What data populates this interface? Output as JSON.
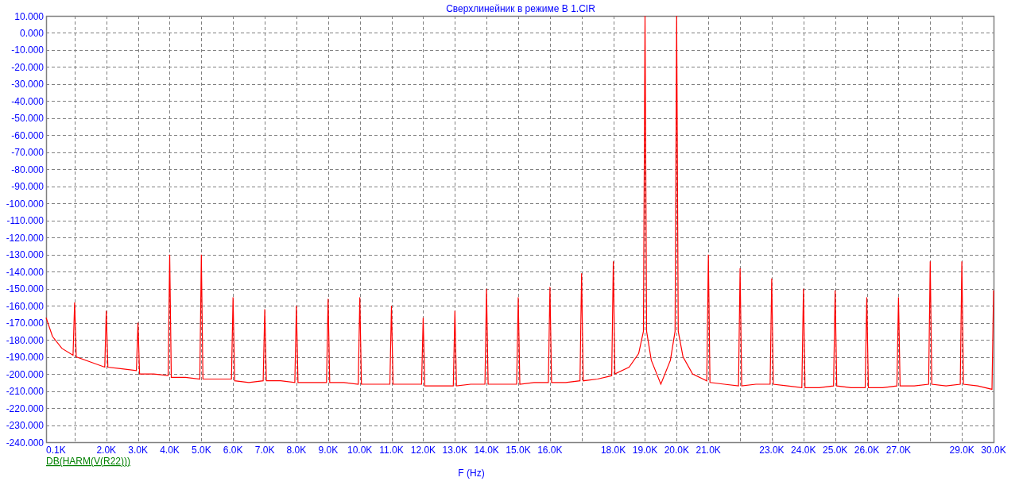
{
  "chart_data": {
    "type": "line",
    "grid": true,
    "title": "Сверхлинейник в режиме B 1.CIR",
    "xlabel": "F (Hz)",
    "xlim": [
      0.1,
      30
    ],
    "ylim": [
      -240,
      10
    ],
    "xticks": [
      {
        "value": 0.1,
        "label": "0.1K"
      },
      {
        "value": 2,
        "label": "2.0K"
      },
      {
        "value": 3,
        "label": "3.0K"
      },
      {
        "value": 4,
        "label": "4.0K"
      },
      {
        "value": 5,
        "label": "5.0K"
      },
      {
        "value": 6,
        "label": "6.0K"
      },
      {
        "value": 7,
        "label": "7.0K"
      },
      {
        "value": 8,
        "label": "8.0K"
      },
      {
        "value": 9,
        "label": "9.0K"
      },
      {
        "value": 10,
        "label": "10.0K"
      },
      {
        "value": 11,
        "label": "11.0K"
      },
      {
        "value": 12,
        "label": "12.0K"
      },
      {
        "value": 13,
        "label": "13.0K"
      },
      {
        "value": 14,
        "label": "14.0K"
      },
      {
        "value": 15,
        "label": "15.0K"
      },
      {
        "value": 16,
        "label": "16.0K"
      },
      {
        "value": 18,
        "label": "18.0K"
      },
      {
        "value": 19,
        "label": "19.0K"
      },
      {
        "value": 20,
        "label": "20.0K"
      },
      {
        "value": 21,
        "label": "21.0K"
      },
      {
        "value": 23,
        "label": "23.0K"
      },
      {
        "value": 24,
        "label": "24.0K"
      },
      {
        "value": 25,
        "label": "25.0K"
      },
      {
        "value": 26,
        "label": "26.0K"
      },
      {
        "value": 27,
        "label": "27.0K"
      },
      {
        "value": 29,
        "label": "29.0K"
      },
      {
        "value": 30,
        "label": "30.0K"
      }
    ],
    "yticks": [
      {
        "value": 10,
        "label": "10.000"
      },
      {
        "value": 0,
        "label": "0.000"
      },
      {
        "value": -10,
        "label": "-10.000"
      },
      {
        "value": -20,
        "label": "-20.000"
      },
      {
        "value": -30,
        "label": "-30.000"
      },
      {
        "value": -40,
        "label": "-40.000"
      },
      {
        "value": -50,
        "label": "-50.000"
      },
      {
        "value": -60,
        "label": "-60.000"
      },
      {
        "value": -70,
        "label": "-70.000"
      },
      {
        "value": -80,
        "label": "-80.000"
      },
      {
        "value": -90,
        "label": "-90.000"
      },
      {
        "value": -100,
        "label": "-100.000"
      },
      {
        "value": -110,
        "label": "-110.000"
      },
      {
        "value": -120,
        "label": "-120.000"
      },
      {
        "value": -130,
        "label": "-130.000"
      },
      {
        "value": -140,
        "label": "-140.000"
      },
      {
        "value": -150,
        "label": "-150.000"
      },
      {
        "value": -160,
        "label": "-160.000"
      },
      {
        "value": -170,
        "label": "-170.000"
      },
      {
        "value": -180,
        "label": "-180.000"
      },
      {
        "value": -190,
        "label": "-190.000"
      },
      {
        "value": -200,
        "label": "-200.000"
      },
      {
        "value": -210,
        "label": "-210.000"
      },
      {
        "value": -220,
        "label": "-220.000"
      },
      {
        "value": -230,
        "label": "-230.000"
      },
      {
        "value": -240,
        "label": "-240.000"
      }
    ],
    "x": [
      0.1,
      0.3,
      0.6,
      0.95,
      1,
      1.05,
      1.5,
      1.95,
      2,
      2.05,
      2.5,
      2.95,
      3,
      3.05,
      3.5,
      3.95,
      4,
      4.05,
      4.5,
      4.95,
      5,
      5.05,
      5.5,
      5.95,
      6,
      6.05,
      6.5,
      6.95,
      7,
      7.05,
      7.5,
      7.95,
      8,
      8.05,
      8.5,
      8.95,
      9,
      9.05,
      9.5,
      9.95,
      10,
      10.05,
      10.5,
      10.95,
      11,
      11.05,
      11.5,
      11.95,
      12,
      12.05,
      12.5,
      12.95,
      13,
      13.05,
      13.5,
      13.95,
      14,
      14.05,
      14.5,
      14.95,
      15,
      15.05,
      15.5,
      15.95,
      16,
      16.05,
      16.5,
      16.95,
      17,
      17.05,
      17.5,
      17.95,
      18,
      18.05,
      18.5,
      18.8,
      18.95,
      19,
      19.05,
      19.2,
      19.5,
      19.8,
      19.95,
      20,
      20.05,
      20.2,
      20.5,
      20.95,
      21,
      21.05,
      21.5,
      21.95,
      22,
      22.05,
      22.5,
      22.95,
      23,
      23.05,
      23.5,
      23.95,
      24,
      24.05,
      24.5,
      24.95,
      25,
      25.05,
      25.5,
      25.95,
      26,
      26.05,
      26.5,
      26.95,
      27,
      27.05,
      27.5,
      27.95,
      28,
      28.05,
      28.5,
      28.95,
      29,
      29.05,
      29.5,
      29.95,
      30
    ],
    "series": [
      {
        "name": "DB(HARM(V(R22)))",
        "color": "#ff0000",
        "values": [
          -167,
          -178,
          -185,
          -189,
          -158,
          -190,
          -193,
          -196,
          -163,
          -196,
          -197,
          -198,
          -170,
          -200,
          -200,
          -201,
          -130,
          -202,
          -202,
          -203,
          -130,
          -203,
          -203,
          -203,
          -155,
          -204,
          -205,
          -204,
          -162,
          -204,
          -204,
          -205,
          -160,
          -205,
          -205,
          -205,
          -156,
          -205,
          -205,
          -206,
          -155,
          -206,
          -206,
          -206,
          -160,
          -206,
          -206,
          -206,
          -167,
          -207,
          -207,
          -207,
          -163,
          -207,
          -206,
          -206,
          -150,
          -206,
          -206,
          -206,
          -155,
          -206,
          -205,
          -205,
          -149,
          -205,
          -205,
          -204,
          -141,
          -204,
          -203,
          -201,
          -134,
          -200,
          -196,
          -188,
          -175,
          10,
          -175,
          -192,
          -206,
          -192,
          -175,
          10,
          -175,
          -190,
          -200,
          -204,
          -130,
          -205,
          -206,
          -207,
          -138,
          -207,
          -206,
          -206,
          -144,
          -206,
          -207,
          -208,
          -150,
          -208,
          -208,
          -207,
          -151,
          -207,
          -208,
          -208,
          -155,
          -208,
          -208,
          -207,
          -155,
          -207,
          -207,
          -206,
          -134,
          -206,
          -207,
          -206,
          -134,
          -206,
          -207,
          -209,
          -151
        ]
      }
    ]
  }
}
